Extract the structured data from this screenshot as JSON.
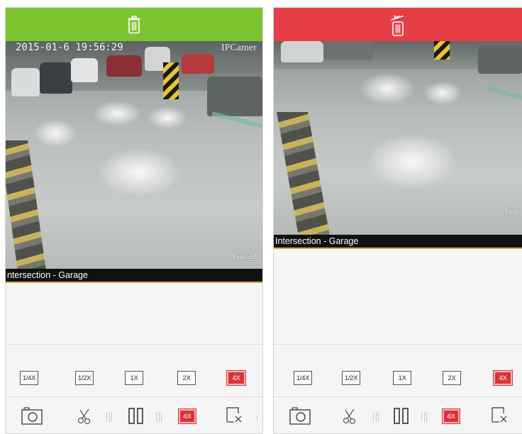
{
  "colors": {
    "left_topbar": "#7cc531",
    "right_topbar": "#e63e45",
    "active_speed": "#d8333a",
    "caption_line": "#d9a52a"
  },
  "left_panel": {
    "topbar_icon": "trash-icon",
    "osd_timestamp": "2015-01-6 19:56:29",
    "osd_camera": "IPCamer",
    "osd_location": "Garag",
    "caption": "ntersection - Garage",
    "speeds": [
      "1/4X",
      "1/2X",
      "1X",
      "2X",
      "4X"
    ],
    "active_speed": "4X",
    "controls": {
      "snapshot_icon": "camera-icon",
      "clip_icon": "scissors-icon",
      "pause_icon": "pause-icon",
      "rate_label": "4X",
      "close_icon": "close-window-icon"
    }
  },
  "right_panel": {
    "topbar_icon": "trash-open-icon",
    "osd_location": "Gar",
    "caption": "Intersection - Garage",
    "speeds": [
      "1/4X",
      "1/2X",
      "1X",
      "2X",
      "4X"
    ],
    "active_speed": "4X",
    "controls": {
      "snapshot_icon": "camera-icon",
      "clip_icon": "scissors-icon",
      "pause_icon": "pause-icon",
      "rate_label": "4X",
      "close_icon": "close-window-icon"
    }
  }
}
